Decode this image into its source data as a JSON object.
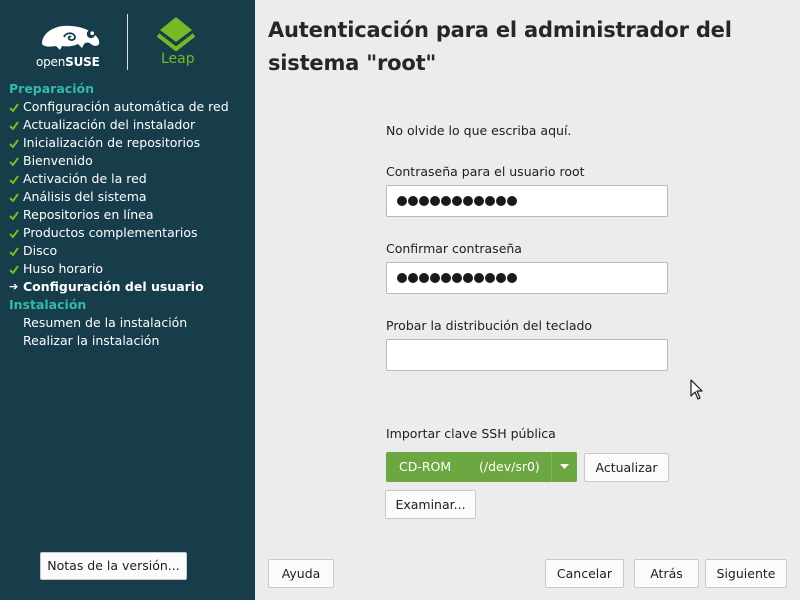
{
  "logos": {
    "opensuse": {
      "text_plain": "open",
      "text_bold": "SUSE",
      "icon": "opensuse-chameleon-icon"
    },
    "leap": {
      "text": "Leap",
      "icon": "leap-diamond-icon"
    }
  },
  "sidebar": {
    "sections": [
      {
        "title": "Preparación",
        "steps": [
          {
            "label": "Configuración automática de red",
            "state": "done"
          },
          {
            "label": "Actualización del instalador",
            "state": "done"
          },
          {
            "label": "Inicialización de repositorios",
            "state": "done"
          },
          {
            "label": "Bienvenido",
            "state": "done"
          },
          {
            "label": "Activación de la red",
            "state": "done"
          },
          {
            "label": "Análisis del sistema",
            "state": "done"
          },
          {
            "label": "Repositorios en línea",
            "state": "done"
          },
          {
            "label": "Productos complementarios",
            "state": "done"
          },
          {
            "label": "Disco",
            "state": "done"
          },
          {
            "label": "Huso horario",
            "state": "done"
          },
          {
            "label": "Configuración del usuario",
            "state": "current"
          }
        ]
      },
      {
        "title": "Instalación",
        "steps": [
          {
            "label": "Resumen de la instalación",
            "state": "pending"
          },
          {
            "label": "Realizar la instalación",
            "state": "pending"
          }
        ]
      }
    ],
    "release_notes_button": "Notas de la versión..."
  },
  "main": {
    "title": "Autenticación para el administrador del sistema \"root\"",
    "note": "No olvide lo que escriba aquí.",
    "password_label": "Contraseña para el usuario root",
    "password_mask_length": 11,
    "confirm_label": "Confirmar contraseña",
    "confirm_mask_length": 11,
    "keyboard_test_label": "Probar la distribución del teclado",
    "keyboard_test_value": "",
    "ssh_label": "Importar clave SSH pública",
    "ssh_device": {
      "label": "CD-ROM",
      "device": "(/dev/sr0)"
    },
    "refresh_button": "Actualizar",
    "browse_button": "Examinar..."
  },
  "footer": {
    "help_button": "Ayuda",
    "cancel_button": "Cancelar",
    "back_button": "Atrás",
    "next_button": "Siguiente"
  },
  "colors": {
    "sidebar_bg": "#173d4b",
    "section_title": "#35b9ab",
    "check": "#73ba25",
    "accent_green": "#6da741",
    "main_bg": "#ececec"
  }
}
